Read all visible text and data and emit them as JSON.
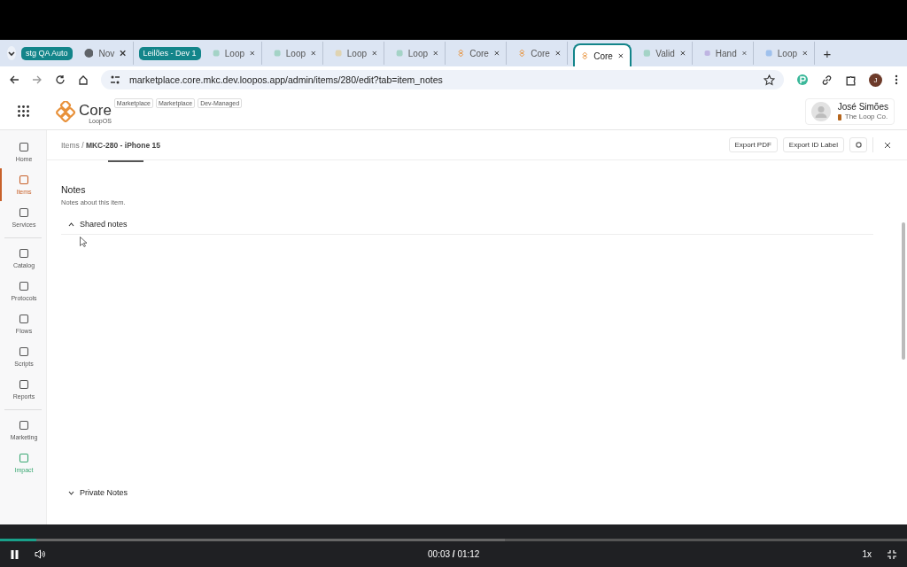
{
  "browser": {
    "tabs": [
      {
        "kind": "group",
        "label": "stg QA Auto",
        "selected": false
      },
      {
        "kind": "tab",
        "label": "Nov",
        "selected": false
      },
      {
        "kind": "group",
        "label": "Leilões - Dev 1",
        "selected": false
      },
      {
        "kind": "tab",
        "label": "Loop",
        "selected": false
      },
      {
        "kind": "tab",
        "label": "Loop",
        "selected": false
      },
      {
        "kind": "tab",
        "label": "Loop",
        "selected": false
      },
      {
        "kind": "tab",
        "label": "Loop",
        "selected": false
      },
      {
        "kind": "tab",
        "label": "Core",
        "selected": false
      },
      {
        "kind": "tab",
        "label": "Core",
        "selected": false
      },
      {
        "kind": "tab",
        "label": "Core",
        "selected": true
      },
      {
        "kind": "tab",
        "label": "Valid",
        "selected": false
      },
      {
        "kind": "tab",
        "label": "Hand",
        "selected": false
      },
      {
        "kind": "tab",
        "label": "Loop",
        "selected": false
      }
    ],
    "new_tab": "+",
    "url": "marketplace.core.mkc.dev.loopos.app/admin/items/280/edit?tab=item_notes",
    "profile_initial": "J"
  },
  "app": {
    "logo": "Core",
    "logo_sub": "LoopOS",
    "tags": [
      "Marketplace",
      "Marketplace",
      "Dev-Managed"
    ],
    "user": {
      "name": "José Simões",
      "org": "The Loop Co."
    },
    "sidebar": {
      "groups": [
        [
          {
            "label": "Home",
            "selected": false,
            "color": "#555555"
          },
          {
            "label": "Items",
            "selected": true,
            "color": "#c8612a"
          },
          {
            "label": "Services",
            "selected": false,
            "color": "#555555"
          }
        ],
        [
          {
            "label": "Catalog",
            "selected": false,
            "color": "#555555"
          },
          {
            "label": "Protocols",
            "selected": false,
            "color": "#555555"
          },
          {
            "label": "Flows",
            "selected": false,
            "color": "#555555"
          },
          {
            "label": "Scripts",
            "selected": false,
            "color": "#555555"
          },
          {
            "label": "Reports",
            "selected": false,
            "color": "#555555"
          }
        ],
        [
          {
            "label": "Marketing",
            "selected": false,
            "color": "#555555"
          },
          {
            "label": "Impact",
            "selected": false,
            "color": "#3aa873"
          }
        ]
      ]
    },
    "breadcrumb": {
      "parent": "Items",
      "separator": "/",
      "current": "MKC-280 - iPhone 15"
    },
    "actions": [
      "Export PDF",
      "Export ID Label"
    ],
    "section": {
      "title": "Notes",
      "subtitle": "Notes about this item.",
      "panels": [
        {
          "title": "Shared notes",
          "expanded": true
        },
        {
          "title": "Private Notes",
          "expanded": false
        }
      ]
    }
  },
  "player": {
    "progress": {
      "level": 0.04
    },
    "buffer": {
      "level": 0.557
    },
    "current_time": "00:03",
    "separator": "/",
    "duration": "01:12",
    "speed": "1x"
  }
}
